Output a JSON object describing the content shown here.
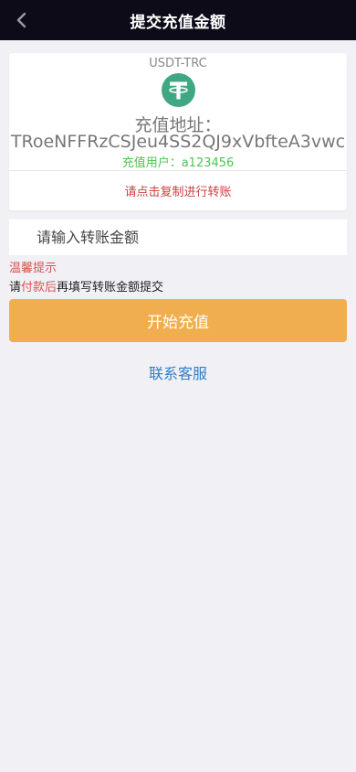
{
  "header": {
    "title": "提交充值金额",
    "back_icon": "chevron-left-icon"
  },
  "card": {
    "network": "USDT-TRC",
    "coin_icon": "tether-icon",
    "coin_color": "#3fa883",
    "address_label": "充值地址：",
    "address_value": "TRoeNFFRzCSJeu4SS2QJ9xVbfteA3vwc",
    "user_prefix": "充值用户：",
    "user_id": "a123456",
    "copy_hint": "请点击复制进行转账"
  },
  "form": {
    "amount_placeholder": "请输入转账金额"
  },
  "tips": {
    "title": "温馨提示",
    "text_prefix": "请",
    "text_highlight": "付款后",
    "text_suffix": "再填写转账金额提交"
  },
  "actions": {
    "start_label": "开始充值",
    "service_label": "联系客服"
  },
  "colors": {
    "header_bg": "#0d0b18",
    "page_bg": "#f1f0f5",
    "accent_orange": "#f1ae4e",
    "link_blue": "#2d7fcb",
    "warning_red": "#d9534f",
    "user_green": "#4cc552"
  }
}
